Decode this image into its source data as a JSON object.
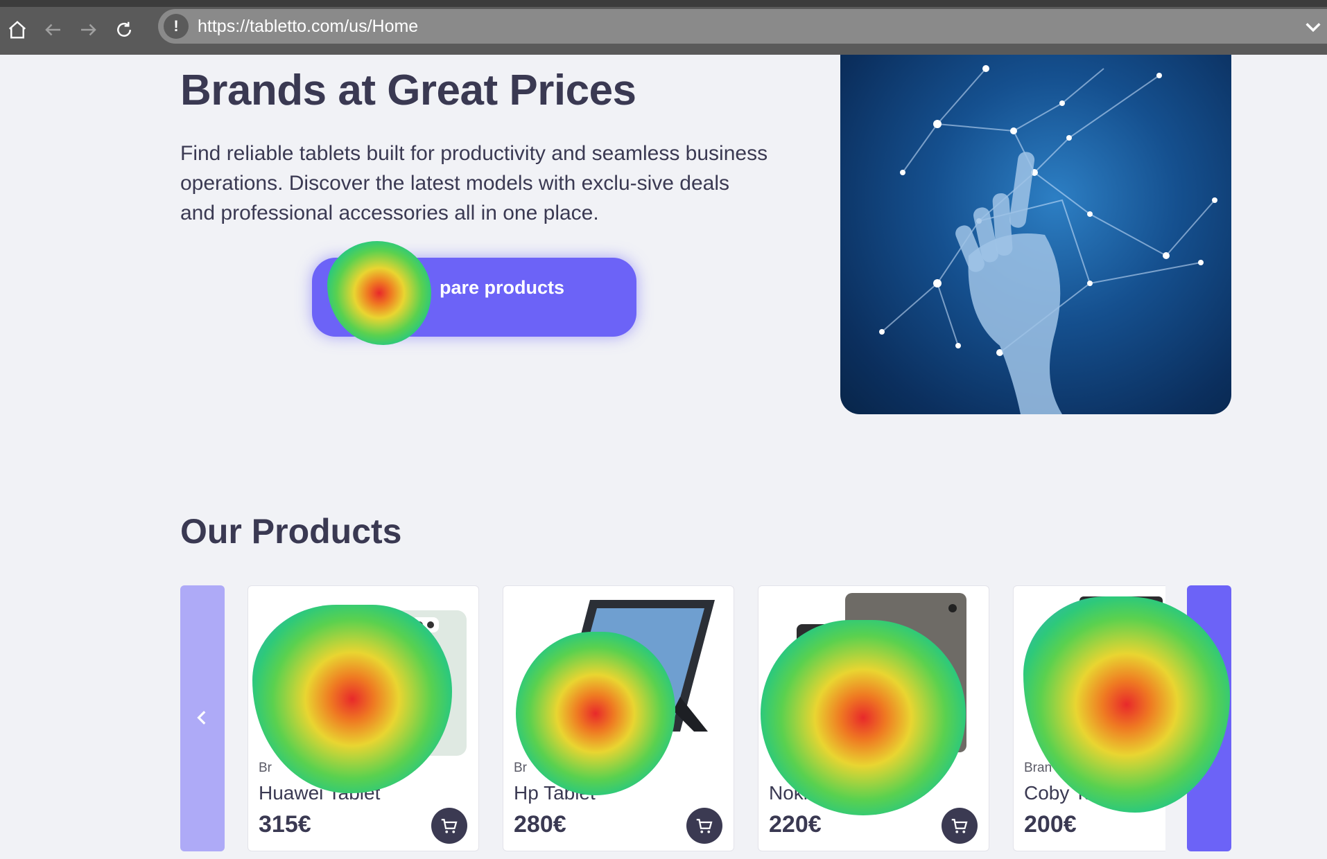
{
  "browser": {
    "url": "https://tabletto.com/us/Home",
    "icons": [
      "home-icon",
      "back-icon",
      "forward-icon",
      "reload-icon",
      "warning-icon",
      "chevron-down-icon"
    ]
  },
  "hero": {
    "title": "Brands at Great Prices",
    "description": "Find reliable tablets built for productivity and seamless business operations. Discover the latest models with exclu-sive deals and professional accessories all in one place.",
    "cta_label": "pare products",
    "image_icon": "robot-hand-network-image"
  },
  "products": {
    "title": "Our Products",
    "prev_icon": "chevron-left-icon",
    "items": [
      {
        "brand": "Br",
        "name": "Huawei Tablet",
        "price": "315€"
      },
      {
        "brand": "Br",
        "name": "Hp Tablet",
        "price": "280€"
      },
      {
        "brand": "",
        "name": "Noki",
        "price": "220€"
      },
      {
        "brand": "Bran",
        "name": "Coby Tabl",
        "price": "200€"
      }
    ]
  },
  "colors": {
    "accent": "#6c63f7",
    "accent_light": "#aeaaf7",
    "text": "#3a3952",
    "background": "#f1f2f6"
  }
}
